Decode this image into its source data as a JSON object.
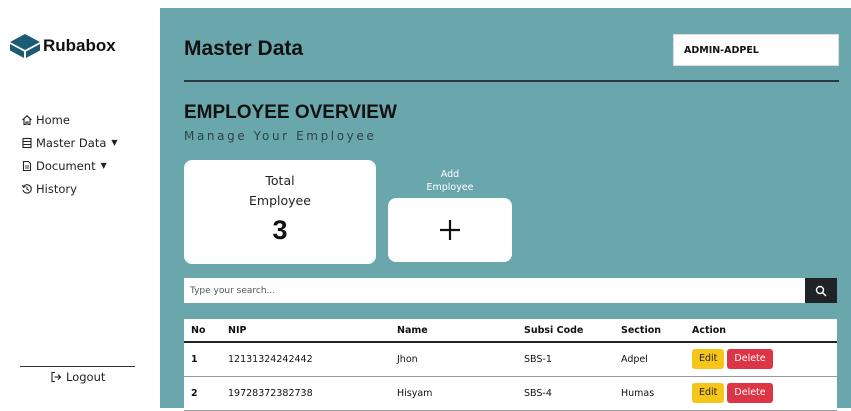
{
  "brand": {
    "name": "Rubabox",
    "icon": "cube-logo-icon",
    "color": "#1d5a73"
  },
  "nav": {
    "items": [
      {
        "label": "Home",
        "icon": "home-icon"
      },
      {
        "label": "Master Data",
        "icon": "database-icon",
        "has_caret": true
      },
      {
        "label": "Document",
        "icon": "document-icon",
        "has_caret": true
      },
      {
        "label": "History",
        "icon": "history-icon"
      }
    ],
    "logout_label": "Logout"
  },
  "header": {
    "title": "Master Data",
    "user": "ADMIN-ADPEL"
  },
  "overview": {
    "title": "EMPLOYEE OVERVIEW",
    "subtitle": "Manage Your Employee",
    "total_label_1": "Total",
    "total_label_2": "Employee",
    "total_value": "3",
    "add_label_1": "Add",
    "add_label_2": "Employee"
  },
  "search": {
    "placeholder": "Type your search..."
  },
  "table": {
    "headers": [
      "No",
      "NIP",
      "Name",
      "Subsi Code",
      "Section",
      "Action"
    ],
    "rows": [
      {
        "no": "1",
        "nip": "12131324242442",
        "name": "Jhon",
        "subsi": "SBS-1",
        "section": "Adpel"
      },
      {
        "no": "2",
        "nip": "19728372382738",
        "name": "Hisyam",
        "subsi": "SBS-4",
        "section": "Humas"
      }
    ],
    "edit_label": "Edit",
    "delete_label": "Delete"
  },
  "colors": {
    "main_bg": "#6aa7ad",
    "edit": "#f5c518",
    "delete": "#dc3545"
  }
}
